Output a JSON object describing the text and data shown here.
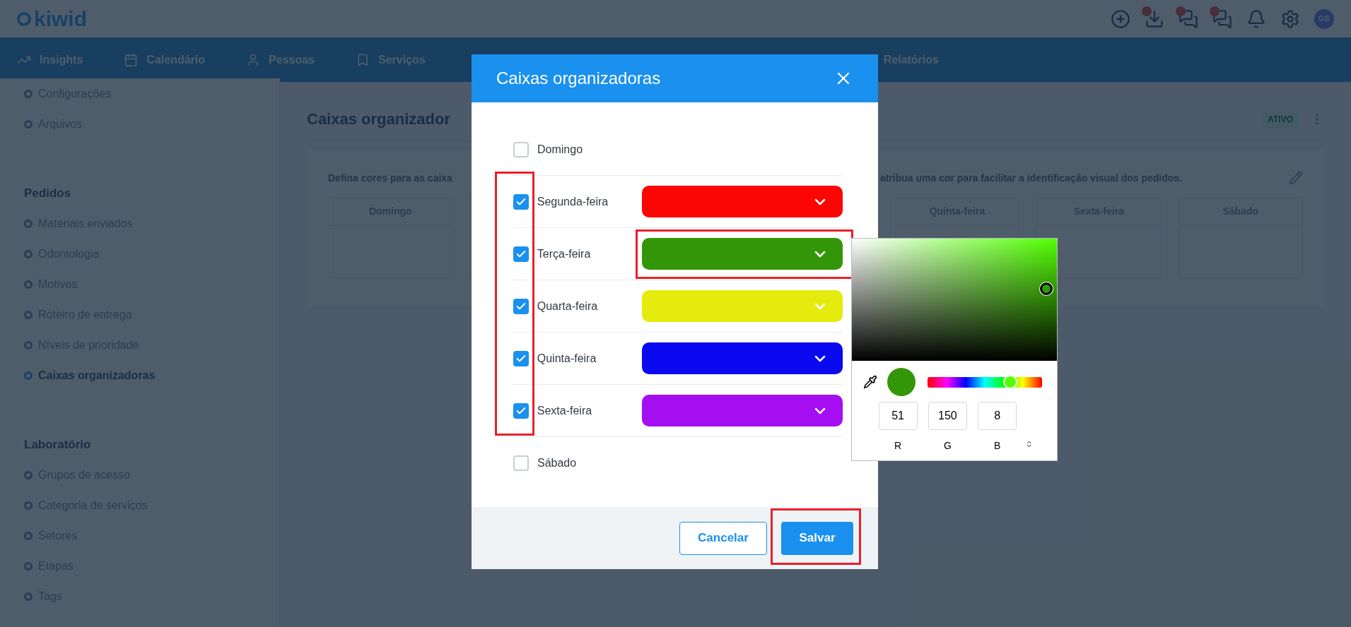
{
  "header": {
    "logo": "kiwid",
    "avatar": "GS"
  },
  "nav": [
    {
      "label": "Insights",
      "kind": "insights"
    },
    {
      "label": "Calendário",
      "kind": "calendar"
    },
    {
      "label": "Pessoas",
      "kind": "people"
    },
    {
      "label": "Serviços",
      "kind": "services"
    },
    {
      "label": "Relatórios",
      "kind": "reports"
    }
  ],
  "sidebar": {
    "sections": [
      {
        "items": [
          {
            "label": "Configurações",
            "selected": false
          },
          {
            "label": "Arquivos",
            "selected": false
          }
        ]
      },
      {
        "title": "Pedidos",
        "items": [
          {
            "label": "Materiais enviados",
            "selected": false
          },
          {
            "label": "Odontologia",
            "selected": false
          },
          {
            "label": "Motivos",
            "selected": false
          },
          {
            "label": "Roteiro de entrega",
            "selected": false
          },
          {
            "label": "Níveis de prioridade",
            "selected": false
          },
          {
            "label": "Caixas organizadoras",
            "selected": true
          }
        ]
      },
      {
        "title": "Laboratório",
        "items": [
          {
            "label": "Grupos de acesso",
            "selected": false
          },
          {
            "label": "Categoria de serviços",
            "selected": false
          },
          {
            "label": "Setores",
            "selected": false
          },
          {
            "label": "Etapas",
            "selected": false
          },
          {
            "label": "Tags",
            "selected": false
          }
        ]
      }
    ]
  },
  "main": {
    "title": "Caixas organizador",
    "status": "ATIVO",
    "description_start": "Defina cores para as caixa",
    "description_end": "atribua uma cor para facilitar a identificação visual dos pedidos.",
    "day_cards": [
      {
        "label": "Domingo"
      },
      {
        "label": "Quinta-feira"
      },
      {
        "label": "Sexta-feira"
      },
      {
        "label": "Sábado"
      }
    ]
  },
  "dialog": {
    "title": "Caixas organizadoras",
    "rows": [
      {
        "label": "Domingo",
        "checked": false
      },
      {
        "label": "Segunda-feira",
        "checked": true,
        "color": "#fb0505"
      },
      {
        "label": "Terça-feira",
        "checked": true,
        "color": "#339608"
      },
      {
        "label": "Quarta-feira",
        "checked": true,
        "color": "#e5eb0c"
      },
      {
        "label": "Quinta-feira",
        "checked": true,
        "color": "#0b09ef"
      },
      {
        "label": "Sexta-feira",
        "checked": true,
        "color": "#a50ef0"
      },
      {
        "label": "Sábado",
        "checked": false
      }
    ],
    "buttons": [
      {
        "label": "Cancelar",
        "kind": "secondary"
      },
      {
        "label": "Salvar",
        "kind": "primary"
      }
    ]
  },
  "color_picker": {
    "level": 0.72,
    "channels": [
      {
        "value": "51",
        "label": "R"
      },
      {
        "value": "150",
        "label": "G"
      },
      {
        "value": "8",
        "label": "B"
      }
    ]
  }
}
